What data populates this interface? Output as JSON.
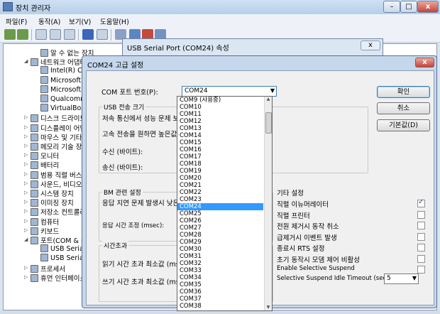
{
  "device_manager": {
    "title": "장치 관리자",
    "menus": [
      "파일(F)",
      "동작(A)",
      "보기(V)",
      "도움말(H)"
    ],
    "tree": [
      {
        "label": "알 수 없는 장치",
        "indent": 2
      },
      {
        "label": "네트워크 어댑터",
        "indent": 1
      },
      {
        "label": "Intel(R) C",
        "indent": 2
      },
      {
        "label": "Microsoft",
        "indent": 2
      },
      {
        "label": "Microsoft",
        "indent": 2
      },
      {
        "label": "Qualcomm",
        "indent": 2
      },
      {
        "label": "VirtualBox",
        "indent": 2
      },
      {
        "label": "디스크 드라이브",
        "indent": 1
      },
      {
        "label": "디스플레이 어댑터",
        "indent": 1
      },
      {
        "label": "마우스 및 기타",
        "indent": 1
      },
      {
        "label": "메모리 기술 장치",
        "indent": 1
      },
      {
        "label": "모니터",
        "indent": 1
      },
      {
        "label": "배터리",
        "indent": 1
      },
      {
        "label": "범용 직렬 버스",
        "indent": 1
      },
      {
        "label": "사운드, 비디오",
        "indent": 1
      },
      {
        "label": "시스템 장치",
        "indent": 1
      },
      {
        "label": "이미징 장치",
        "indent": 1
      },
      {
        "label": "저장소 컨트롤러",
        "indent": 1
      },
      {
        "label": "컴퓨터",
        "indent": 1
      },
      {
        "label": "키보드",
        "indent": 1
      },
      {
        "label": "포트(COM & L",
        "indent": 1
      },
      {
        "label": "USB Serial",
        "indent": 2
      },
      {
        "label": "USB Serial",
        "indent": 2
      },
      {
        "label": "프로세서",
        "indent": 1
      },
      {
        "label": "휴먼 인터페이스",
        "indent": 1
      }
    ]
  },
  "properties_dialog": {
    "title": "USB Serial Port (COM24) 속성",
    "close": "x"
  },
  "advanced_dialog": {
    "title": "COM24 고급 설정",
    "close": "x",
    "com_port_label": "COM 포트 번호(P):",
    "com_port_value": "COM24",
    "usb_group_title": "USB 전송 크기",
    "usb_desc1": "저속 통신에서 성능 문제 보",
    "usb_desc2": "고속 전송을 원하면 높은값",
    "receive_label": "수신 (바이트):",
    "send_label": "송신 (바이트):",
    "bm_group_title": "BM 관련 설정",
    "latency_label": "응답 지연 문제 발생시 낮은",
    "latency_timer_label": "응답 시간 조정 (msec):",
    "timeout_group_title": "시간초과",
    "read_timeout_label": "읽기 시간 초과 최소값 (ms",
    "write_timeout_label": "쓰기 시간 초과 최소값 (ms",
    "ok_button": "확인",
    "cancel_button": "취소",
    "defaults_button": "기본값(D)",
    "misc_group_title": "기타 설정",
    "options": [
      {
        "label": "직렬 이뉴머레이터",
        "checked": true
      },
      {
        "label": "직렬 프린터",
        "checked": false
      },
      {
        "label": "전원 제거시 동작 취소",
        "checked": false
      },
      {
        "label": "급제거시 이벤트 발생",
        "checked": false
      },
      {
        "label": "종료시 RTS 설정",
        "checked": false
      },
      {
        "label": "초기 동작시 모뎀 제어 비활성",
        "checked": false
      },
      {
        "label": "Enable Selective Suspend",
        "checked": false
      }
    ],
    "suspend_timeout_label": "Selective Suspend Idle Timeout (secs):",
    "suspend_timeout_value": "5",
    "com_list": [
      "COM9 (사용중)",
      "COM10",
      "COM11",
      "COM12",
      "COM13",
      "COM14",
      "COM15",
      "COM16",
      "COM17",
      "COM18",
      "COM19",
      "COM20",
      "COM21",
      "COM22",
      "COM23",
      "COM24",
      "COM25",
      "COM26",
      "COM27",
      "COM28",
      "COM29",
      "COM30",
      "COM31",
      "COM32",
      "COM33",
      "COM34",
      "COM35",
      "COM36",
      "COM37",
      "COM38"
    ],
    "selected_index": 15
  }
}
